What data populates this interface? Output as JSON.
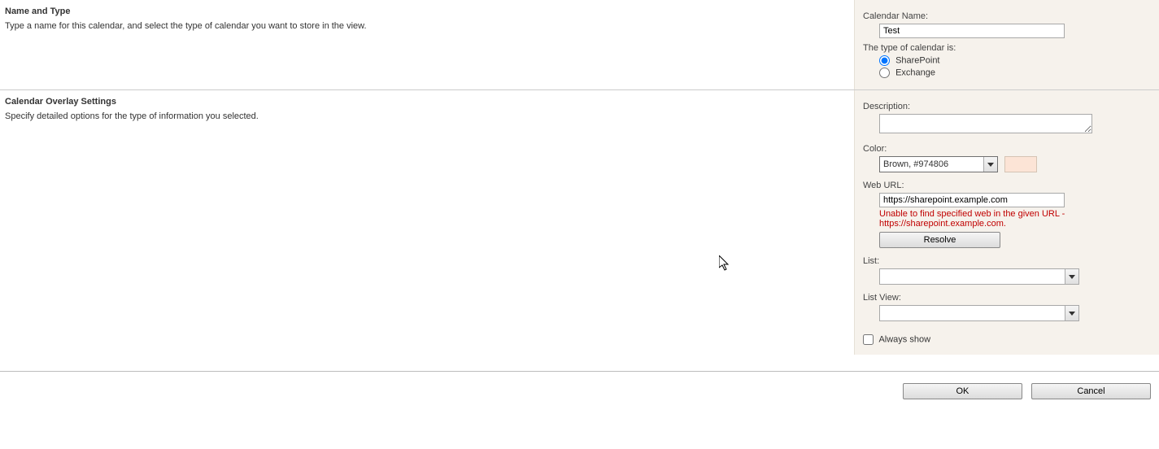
{
  "section1": {
    "title": "Name and Type",
    "desc": "Type a name for this calendar, and select the type of calendar you want to store in the view.",
    "calendar_name_label": "Calendar Name:",
    "calendar_name_value": "Test",
    "type_label": "The type of calendar is:",
    "radio_sharepoint": "SharePoint",
    "radio_exchange": "Exchange"
  },
  "section2": {
    "title": "Calendar Overlay Settings",
    "desc": "Specify detailed options for the type of information you selected.",
    "description_label": "Description:",
    "description_value": "",
    "color_label": "Color:",
    "color_selected": "Brown, #974806",
    "color_swatch": "#fce4d6",
    "web_url_label": "Web URL:",
    "web_url_value": "https://sharepoint.example.com",
    "error_text": "Unable to find specified web in the given URL - https://sharepoint.example.com.",
    "resolve_btn": "Resolve",
    "list_label": "List:",
    "list_value": "",
    "list_view_label": "List View:",
    "list_view_value": "",
    "always_show_label": "Always show"
  },
  "footer": {
    "ok": "OK",
    "cancel": "Cancel"
  }
}
